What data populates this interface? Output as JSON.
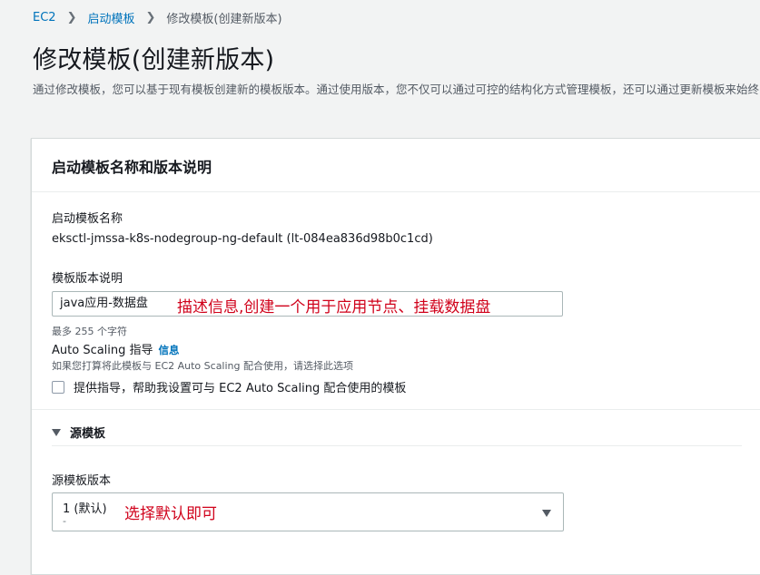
{
  "breadcrumb": {
    "items": [
      "EC2",
      "启动模板",
      "修改模板(创建新版本)"
    ]
  },
  "page": {
    "title": "修改模板(创建新版本)",
    "description": "通过修改模板，您可以基于现有模板创建新的模板版本。通过使用版本，您不仅可以通过可控的结构化方式管理模板，还可以通过更新模板来始终使用原定设置版本的模板，而无需更改对模板名称或 ID 的引用。"
  },
  "panel": {
    "title": "启动模板名称和版本说明",
    "template_name_label": "启动模板名称",
    "template_name_value": "eksctl-jmssa-k8s-nodegroup-ng-default (lt-084ea836d98b0c1cd)",
    "version_desc_label": "模板版本说明",
    "version_desc_value": "java应用-数据盘",
    "version_desc_annotation": "描述信息,创建一个用于应用节点、挂载数据盘",
    "max_chars_hint": "最多 255 个字符",
    "auto_scaling_label": "Auto Scaling 指导",
    "info_link": "信息",
    "auto_scaling_hint": "如果您打算将此模板与 EC2 Auto Scaling 配合使用，请选择此选项",
    "checkbox_label": "提供指导，帮助我设置可与 EC2 Auto Scaling 配合使用的模板"
  },
  "source_template": {
    "section_title": "源模板",
    "version_label": "源模板版本",
    "selected_value": "1 (默认)",
    "selected_sub": "-",
    "annotation": "选择默认即可"
  },
  "colors": {
    "link": "#0073bb",
    "annotation": "#d0021b",
    "background": "#f2f3f3"
  }
}
